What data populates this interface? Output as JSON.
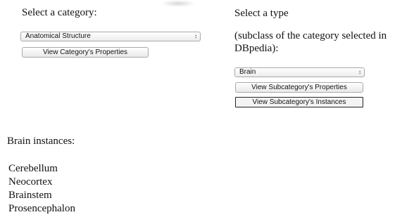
{
  "left_panel": {
    "heading": "Select a category:",
    "category_select_value": "Anatomical Structure",
    "view_category_properties_label": "View Category's Properties"
  },
  "right_panel": {
    "heading": "Select a type",
    "subheading": "(subclass of the category selected in DBpedia):",
    "type_select_value": "Brain",
    "view_subcategory_properties_label": "View Subcategory's Properties",
    "view_subcategory_instances_label": "View Subcategory's Instances"
  },
  "results": {
    "heading": "Brain instances:",
    "items": [
      "Cerebellum",
      "Neocortex",
      "Brainstem",
      "Prosencephalon"
    ]
  },
  "icons": {
    "select_chevron": "up-down-chevron-icon"
  }
}
